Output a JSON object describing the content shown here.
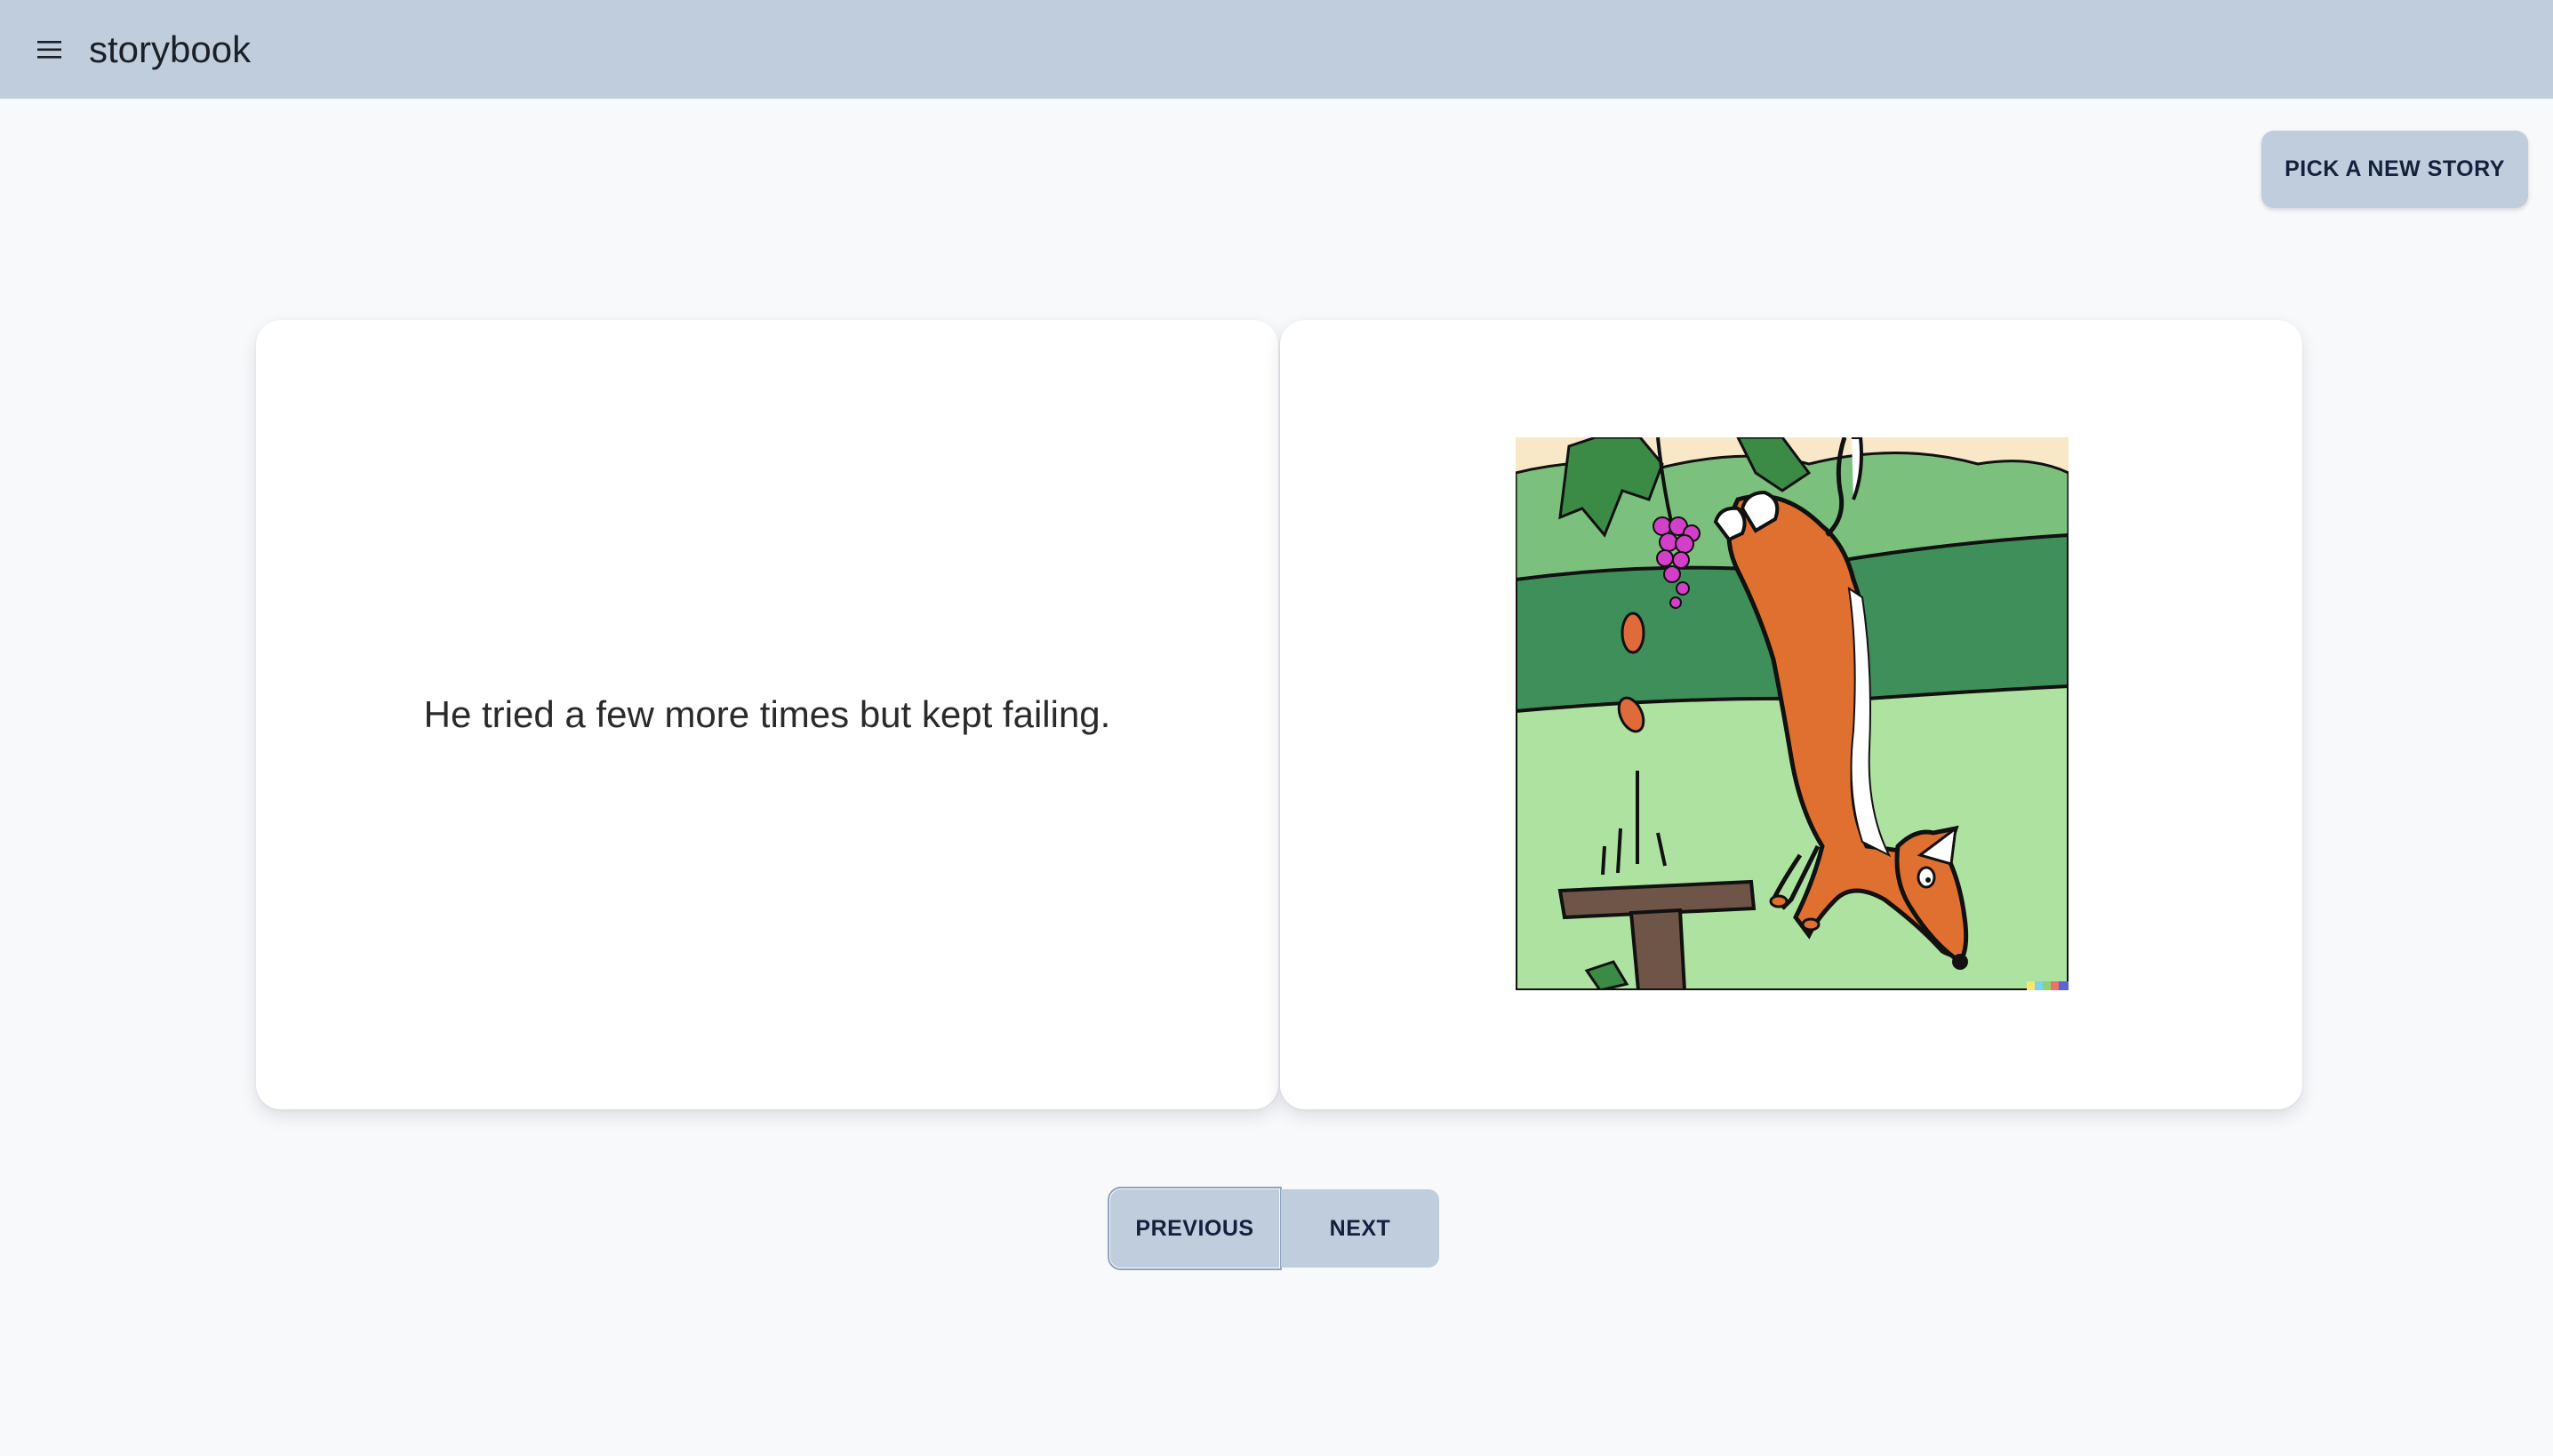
{
  "header": {
    "app_title": "storybook",
    "menu_icon": "hamburger-menu-icon"
  },
  "actions": {
    "pick_story_label": "PICK A NEW STORY"
  },
  "page": {
    "text": "He tried a few more times but kept failing.",
    "illustration": "fox jumping for grapes illustration"
  },
  "navigation": {
    "previous_label": "PREVIOUS",
    "next_label": "NEXT"
  },
  "colors": {
    "accent": "#bfcddd",
    "background": "#f8f9fb",
    "button_text": "#14213d"
  }
}
